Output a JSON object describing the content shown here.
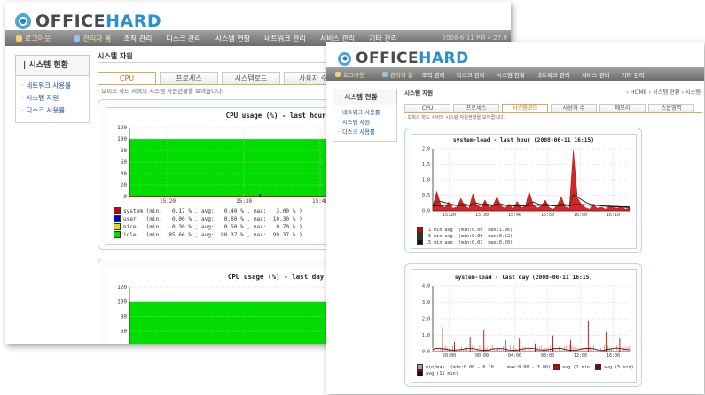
{
  "window_a": {
    "logo": {
      "office": "OFFICE",
      "hard": "HARD"
    },
    "menubar": {
      "user": "로그아웃",
      "admin": "관리자 홈",
      "items": [
        "조직 관리",
        "디스크 관리",
        "시스템 현황",
        "네트워크 관리",
        "서비스 관리",
        "기타 관리"
      ],
      "date": "2008-6-11 PM 4:27:9"
    },
    "sidebar": {
      "title": "시스템 현황",
      "items": [
        "네트워크 사용률",
        "시스템 자원",
        "디스크 사용률"
      ]
    },
    "page_title": "시스템 자원",
    "tabs": [
      {
        "label": "CPU",
        "active": true
      },
      {
        "label": "프로세스",
        "active": false
      },
      {
        "label": "시스템로드",
        "active": false
      },
      {
        "label": "사용자 수",
        "active": false
      }
    ],
    "description": "· 오피스 하드 서버의 시스템 자원현황을 보여줍니다.",
    "graph_hour": {
      "title": "CPU usage (%) - last hour (2008-06-11 16:15)",
      "legend": [
        "system (min:   0.17 % , avg:   0.40 % , max:   3.00 % )",
        "user   (min:   0.00 % , avg:   0.60 % , max:  10.30 % )",
        "nice   (min:   0.30 % , avg:   0.50 % , max:   0.70 % )",
        "idle   (min:  85.66 % , avg:  98.37 % , max:  99.37 % )"
      ]
    },
    "graph_day": {
      "title": "CPU usage (%) - last day (2008-06-11 16:15)"
    }
  },
  "window_b": {
    "logo": {
      "office": "OFFICE",
      "hard": "HARD"
    },
    "menubar": {
      "user": "로그아웃",
      "admin": "관리자 홈",
      "items": [
        "조직 관리",
        "디스크 관리",
        "시스템 현황",
        "네트워크 관리",
        "서비스 관리",
        "기타 관리"
      ]
    },
    "sidebar": {
      "title": "시스템 현황",
      "items": [
        "네트워크 사용률",
        "시스템 자원",
        "디스크 사용률"
      ]
    },
    "page_title": "시스템 자원",
    "breadcrumb": "› HOME › 시스템 현황 › 시스템",
    "tabs": [
      {
        "label": "CPU",
        "active": false
      },
      {
        "label": "프로세스",
        "active": false
      },
      {
        "label": "시스템로드",
        "active": true
      },
      {
        "label": "사용자 수",
        "active": false
      },
      {
        "label": "메모리",
        "active": false
      },
      {
        "label": "스왑영역",
        "active": false
      }
    ],
    "description": "· 오피스 하드 서버의 시스템 자원현황을 보여줍니다.",
    "graph_hour": {
      "title": "system-load - last hour (2008-06-11 16:15)",
      "legend": [
        " 1 min avg  (min:0.00  max:1.96)",
        " 5 min avg  (min:0.00  max:0.52)",
        "15 min avg  (min:0.07  max:0.20)"
      ]
    },
    "graph_day": {
      "title": "system-load - last day (2008-06-11 16:15)",
      "legend": [
        "min/max  (min:0.00 - 0.10     max:0.00 - 3.80)",
        "avg (1 min)",
        "avg (5 min)",
        "avg (15 min)"
      ]
    }
  },
  "chart_data": [
    {
      "type": "area",
      "title": "CPU usage (%) - last hour (2008-06-11 16:15)",
      "x_ticks": [
        "15:20",
        "15:30",
        "15:40",
        "15:50",
        "16:00"
      ],
      "ylim": [
        0,
        120
      ],
      "y_ticks": [
        0,
        20,
        40,
        60,
        80,
        100,
        120
      ],
      "series": [
        {
          "name": "system",
          "color": "#cc0000"
        },
        {
          "name": "user",
          "color": "#0000cc"
        },
        {
          "name": "nice",
          "color": "#dddd00"
        },
        {
          "name": "idle",
          "color": "#00dd00"
        }
      ],
      "spikes": [
        {
          "x": 0.34,
          "value": 4
        },
        {
          "x": 0.55,
          "value": 6
        },
        {
          "x": 0.82,
          "value": 5
        },
        {
          "x": 0.94,
          "value": 3
        }
      ]
    },
    {
      "type": "area",
      "title": "CPU usage (%) - last day (2008-06-11 16:15)",
      "ylim": [
        0,
        120
      ],
      "y_ticks": [
        20,
        40,
        60,
        80,
        100,
        120
      ],
      "series": [
        {
          "name": "idle",
          "color": "#00dd00"
        }
      ]
    },
    {
      "type": "area",
      "title": "system-load - last hour (2008-06-11 16:15)",
      "x_ticks": [
        "15:20",
        "15:30",
        "15:40",
        "15:50",
        "16:00",
        "16:10"
      ],
      "ylim": [
        0,
        2.0
      ],
      "y_ticks": [
        0.0,
        0.5,
        1.0,
        1.5,
        2.0
      ],
      "series": [
        {
          "name": "1 min avg",
          "color": "#cc0000",
          "values": [
            0.15,
            0.62,
            0.2,
            0.1,
            0.28,
            0.08,
            0.12,
            0.4,
            0.15,
            0.08,
            0.55,
            0.18,
            0.1,
            0.35,
            0.1,
            0.18,
            0.45,
            0.15,
            0.08,
            0.22,
            0.05,
            0.3,
            0.1,
            0.12,
            0.62,
            0.2,
            0.08,
            0.15,
            0.35,
            0.1,
            0.05,
            0.18,
            0.45,
            0.12,
            0.08,
            1.96,
            0.42,
            0.2,
            0.1,
            0.05,
            0.18,
            0.08,
            0.12,
            0.05,
            0.15,
            0.1,
            0.08,
            0.12,
            0.05,
            0.1
          ]
        },
        {
          "name": "5 min avg",
          "color": "#333333",
          "values": [
            0.2,
            0.28,
            0.3,
            0.26,
            0.24,
            0.2,
            0.18,
            0.22,
            0.22,
            0.18,
            0.24,
            0.25,
            0.2,
            0.22,
            0.2,
            0.18,
            0.23,
            0.22,
            0.18,
            0.18,
            0.15,
            0.17,
            0.16,
            0.14,
            0.26,
            0.28,
            0.22,
            0.2,
            0.22,
            0.19,
            0.16,
            0.16,
            0.22,
            0.2,
            0.16,
            0.52,
            0.45,
            0.36,
            0.28,
            0.22,
            0.2,
            0.17,
            0.16,
            0.14,
            0.14,
            0.13,
            0.12,
            0.12,
            0.11,
            0.1
          ]
        },
        {
          "name": "15 min avg",
          "color": "#111111",
          "values": [
            0.15,
            0.16,
            0.17,
            0.17,
            0.18,
            0.18,
            0.17,
            0.17,
            0.17,
            0.17,
            0.18,
            0.18,
            0.18,
            0.18,
            0.17,
            0.17,
            0.18,
            0.18,
            0.17,
            0.17,
            0.16,
            0.16,
            0.16,
            0.15,
            0.17,
            0.18,
            0.18,
            0.17,
            0.17,
            0.17,
            0.16,
            0.16,
            0.17,
            0.17,
            0.16,
            0.2,
            0.2,
            0.2,
            0.19,
            0.18,
            0.17,
            0.17,
            0.16,
            0.15,
            0.15,
            0.14,
            0.14,
            0.13,
            0.13,
            0.12
          ]
        }
      ]
    },
    {
      "type": "line",
      "title": "system-load - last day (2008-06-11 16:15)",
      "x_ticks": [
        "20:00",
        "00:00",
        "04:00",
        "08:00",
        "12:00",
        "16:00"
      ],
      "ylim": [
        0,
        4.0
      ],
      "y_ticks": [
        0.0,
        1.0,
        2.0,
        3.0,
        4.0
      ],
      "series": [
        {
          "name": "min/max",
          "color": "#d88a8a"
        },
        {
          "name": "avg (1 min)",
          "color": "#cc0000"
        },
        {
          "name": "avg (5 min)",
          "color": "#880000"
        },
        {
          "name": "avg (15 min)",
          "color": "#440000"
        }
      ],
      "spikes": [
        {
          "x": 0.05,
          "value": 1.5
        },
        {
          "x": 0.11,
          "value": 0.6
        },
        {
          "x": 0.19,
          "value": 0.9
        },
        {
          "x": 0.26,
          "value": 1.3
        },
        {
          "x": 0.37,
          "value": 0.7
        },
        {
          "x": 0.44,
          "value": 0.8
        },
        {
          "x": 0.52,
          "value": 0.5
        },
        {
          "x": 0.61,
          "value": 1.0
        },
        {
          "x": 0.7,
          "value": 0.7
        },
        {
          "x": 0.79,
          "value": 1.9
        },
        {
          "x": 0.88,
          "value": 1.2
        },
        {
          "x": 0.95,
          "value": 0.8
        }
      ]
    }
  ]
}
